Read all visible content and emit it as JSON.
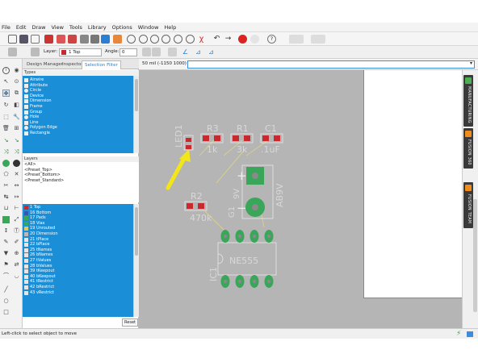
{
  "menu": [
    "File",
    "Edit",
    "Draw",
    "View",
    "Tools",
    "Library",
    "Options",
    "Window",
    "Help"
  ],
  "toolbar": {
    "layer_label": "Layer:",
    "layer_value": "1 Top",
    "angle_label": "Angle:",
    "angle_value": "0",
    "grid_value": "50 mil (-1150 1000)",
    "layer_color": "#c8292e"
  },
  "panel": {
    "tabs": [
      "Design Manager",
      "Inspector",
      "Selection Filter"
    ],
    "types_label": "Types",
    "types": [
      "Airwire",
      "Attribute",
      "Circle",
      "Device",
      "Dimension",
      "Frame",
      "Group",
      "Hole",
      "Line",
      "Polygon Edge",
      "Rectangle"
    ],
    "layers_label": "Layers",
    "presets": [
      "<All>",
      "<Preset_Top>",
      "<Preset_Bottom>",
      "<Preset_Standard>"
    ],
    "layers": [
      {
        "name": "1 Top",
        "color": "#c8292e"
      },
      {
        "name": "16 Bottom",
        "color": "#2a5db0"
      },
      {
        "name": "17 Pads",
        "color": "#3aa65a"
      },
      {
        "name": "18 Vias",
        "color": "#3aa65a"
      },
      {
        "name": "19 Unrouted",
        "color": "#d9c96b"
      },
      {
        "name": "20 Dimension",
        "color": "#b9b9b9"
      },
      {
        "name": "21 tPlace",
        "color": "#e5e5e5"
      },
      {
        "name": "22 bPlace",
        "color": "#e5e5e5"
      },
      {
        "name": "25 tNames",
        "color": "#e5e5e5"
      },
      {
        "name": "26 bNames",
        "color": "#e5e5e5"
      },
      {
        "name": "27 tValues",
        "color": "#e5e5e5"
      },
      {
        "name": "28 bValues",
        "color": "#e5e5e5"
      },
      {
        "name": "39 tKeepout",
        "color": "#e5e5e5"
      },
      {
        "name": "40 bKeepout",
        "color": "#e5e5e5"
      },
      {
        "name": "41 tRestrict",
        "color": "#e5e5e5"
      },
      {
        "name": "42 bRestrict",
        "color": "#e5e5e5"
      },
      {
        "name": "43 vRestrict",
        "color": "#e5e5e5"
      }
    ],
    "reset_label": "Reset"
  },
  "board": {
    "labels": {
      "led1": "LED1",
      "r3": "R3",
      "r3v": "1k",
      "r1": "R1",
      "r1v": "3k",
      "c1": "C1",
      "c1v": ".1uF",
      "r2": "R2",
      "r2v": "470k",
      "g1": "G1",
      "g1v": "9V",
      "ab9v": "AB9V",
      "ne555": "NE555",
      "ic1": "IC1",
      "plus": "+",
      "minus": "−"
    },
    "pad_color": "#c8292e",
    "through_color": "#3aa65a"
  },
  "right_tabs": [
    "MANUFACTURING",
    "FUSION 360",
    "FUSION TEAM"
  ],
  "status": "Left-click to select object to move"
}
